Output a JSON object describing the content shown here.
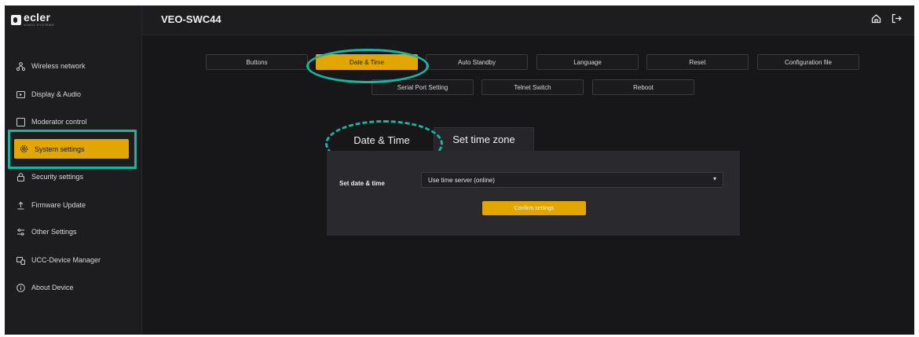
{
  "app": {
    "logo_text": "ecler",
    "logo_sub": "VIDEO SYSTEMS",
    "device_title": "VEO-SWC44"
  },
  "sidebar": {
    "items": [
      {
        "label": "Wireless network",
        "icon": "network-icon"
      },
      {
        "label": "Display & Audio",
        "icon": "display-icon"
      },
      {
        "label": "Moderator control",
        "icon": "square-icon"
      },
      {
        "label": "System settings",
        "icon": "gear-icon",
        "active": true
      },
      {
        "label": "Security settings",
        "icon": "lock-icon"
      },
      {
        "label": "Firmware Update",
        "icon": "upload-icon"
      },
      {
        "label": "Other Settings",
        "icon": "sliders-icon"
      },
      {
        "label": "UCC-Device Manager",
        "icon": "device-manager-icon"
      },
      {
        "label": "About Device",
        "icon": "info-icon"
      }
    ]
  },
  "header_icons": [
    "home-icon",
    "logout-icon"
  ],
  "settings_tabs": {
    "row1": [
      "Buttons",
      "Date & Time",
      "Auto Standby",
      "Language",
      "Reset",
      "Configuration file"
    ],
    "row2": [
      "Serial Port Setting",
      "Telnet Switch",
      "Reboot"
    ],
    "active": "Date & Time"
  },
  "subtabs": {
    "items": [
      "Date & Time",
      "Set time zone"
    ],
    "active": "Date & Time"
  },
  "form": {
    "set_date_time_label": "Set date & time",
    "set_date_time_value": "Use time server (online)",
    "confirm_label": "Confirm settings"
  },
  "colors": {
    "accent": "#e2a600",
    "highlight": "#1ab5a0",
    "background": "#17171a",
    "panel": "#2a2a2e"
  }
}
